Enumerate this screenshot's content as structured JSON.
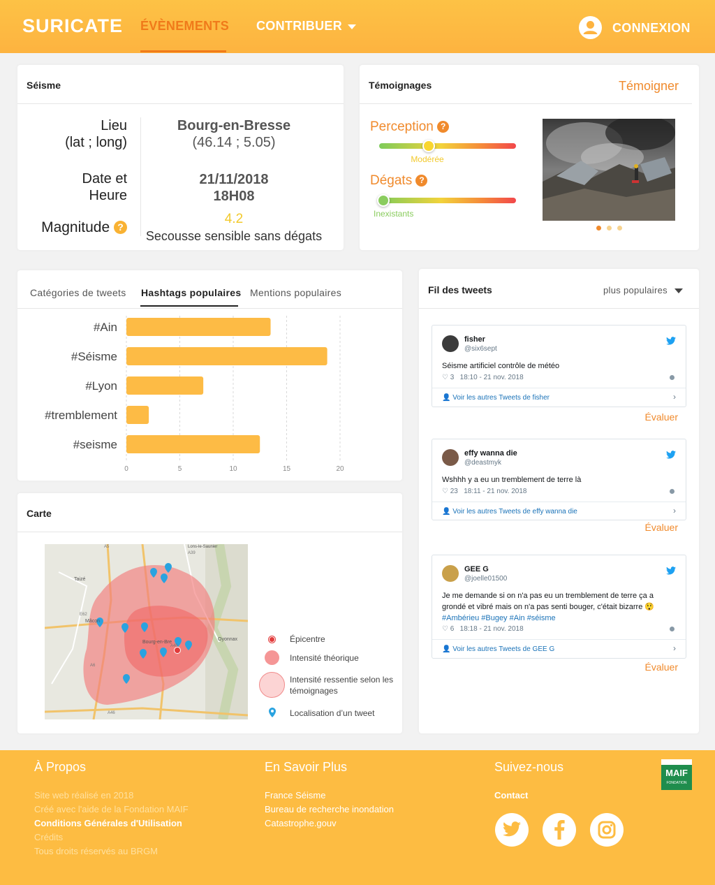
{
  "header": {
    "logo": "SURICATE",
    "nav": {
      "events": "ÉVÈNEMENTS",
      "contribute": "CONTRIBUER",
      "login": "CONNEXION"
    }
  },
  "seisme": {
    "title": "Séisme",
    "place_label": "Lieu\n(lat ; long)",
    "place_value": "Bourg-en-Bresse",
    "coords": "(46.14 ; 5.05)",
    "date_label": "Date et\nHeure",
    "date_value": "21/11/2018",
    "time_value": "18H08",
    "magnitude_label": "Magnitude",
    "magnitude_value": "4.2",
    "magnitude_desc": "Secousse sensible sans dégats"
  },
  "temoignages": {
    "title": "Témoignages",
    "action": "Témoigner",
    "perception_label": "Perception",
    "perception_value": "Modérée",
    "perception_level": 0.36,
    "degats_label": "Dégats",
    "degats_value": "Inexistants",
    "degats_level": 0.03,
    "carousel_dots": 3,
    "carousel_active": 0
  },
  "tabs": {
    "categories": "Catégories de tweets",
    "hashtags": "Hashtags populaires",
    "mentions": "Mentions populaires"
  },
  "chart_data": {
    "type": "bar",
    "orientation": "horizontal",
    "categories": [
      "#Ain",
      "#Séisme",
      "#Lyon",
      "#tremblement",
      "#seisme"
    ],
    "values": [
      13.5,
      18.8,
      7.2,
      2.1,
      12.5
    ],
    "xlim": [
      0,
      20
    ],
    "xticks": [
      "0",
      "5",
      "10",
      "15",
      "20"
    ],
    "grid": true,
    "color": "#fdbb45"
  },
  "carte": {
    "title": "Carte",
    "legend": {
      "epicentre": "Épicentre",
      "theorique": "Intensité théorique",
      "ressentie": "Intensité ressentie selon les témoignages",
      "tweet": "Localisation d’un tweet"
    },
    "map_labels": {
      "taize": "Taizé",
      "macon": "Mâcon",
      "bourg": "Bourg-en-Bre",
      "oyonnax": "Oyonnax",
      "lons": "Lons-le-Saunier",
      "a6": "A6",
      "a40": "A40",
      "a39": "A39",
      "e62": "E62",
      "a46": "A46",
      "a5": "A5"
    }
  },
  "tweets": {
    "title": "Fil des tweets",
    "sort": "plus populaires",
    "rate": "Évaluer",
    "items": [
      {
        "name": "fisher",
        "handle": "@six6sept",
        "text": "Séisme artificiel contrôle de météo",
        "likes": "3",
        "time": "18:10 - 21 nov. 2018",
        "more": "Voir les autres Tweets de fisher"
      },
      {
        "name": "effy wanna die",
        "handle": "@deastmyk",
        "text": "Wshhh y a eu un tremblement de terre là",
        "likes": "23",
        "time": "18:11 - 21 nov. 2018",
        "more": "Voir les autres Tweets de effy wanna die"
      },
      {
        "name": "GEE G",
        "handle": "@joelle01500",
        "text": "Je me demande si on n'a pas eu un tremblement de terre ça a grondé et vibré mais on n'a pas senti bouger, c'était bizarre 😲",
        "tags": "#Ambérieu #Bugey #Ain #séisme",
        "likes": "6",
        "time": "18:18 - 21 nov. 2018",
        "more": "Voir les autres Tweets de GEE G"
      }
    ]
  },
  "footer": {
    "about_title": "À Propos",
    "about_lines": [
      "Site web réalisé en 2018",
      "Créé avec l'aide de la Fondation MAIF",
      "Conditions Générales d'Utilisation",
      "Crédits",
      "Tous droits réservés au BRGM"
    ],
    "more_title": "En Savoir Plus",
    "more_lines": [
      "France Séisme",
      "Bureau de recherche inondation",
      "Catastrophe.gouv"
    ],
    "follow_title": "Suivez-nous",
    "contact": "Contact",
    "maif": "MAIF",
    "maif_sub": "FONDATION"
  },
  "colors": {
    "accent": "#f08a2c",
    "header": "#fdb340",
    "bar": "#fdbb45"
  }
}
